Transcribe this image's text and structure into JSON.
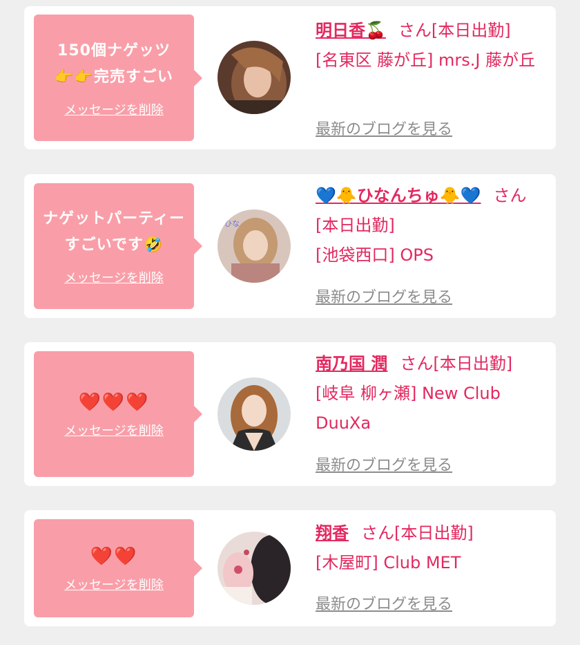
{
  "common": {
    "delete_label": "メッセージを削除",
    "blog_label": "最新のブログを見る",
    "san": "さん",
    "status": "[本日出勤]"
  },
  "colors": {
    "background": "#efefef",
    "card": "#ffffff",
    "bubble": "#f99ea8",
    "accent": "#e2285f",
    "link_gray": "#8c8c8c"
  },
  "messages": [
    {
      "bubble_text": "150個ナゲッツ👉👉完売すごい",
      "name": "明日香🍒",
      "location": "[名東区 藤が丘] mrs.J 藤が丘"
    },
    {
      "bubble_text": "ナゲットパーティーすごいです🤣",
      "name": "💙🐥ひなんちゅ🐥💙",
      "location": "[池袋西口] OPS"
    },
    {
      "bubble_text": "❤️❤️❤️",
      "name": "南乃国 潤",
      "location": "[岐阜 柳ヶ瀬] New Club DuuXa"
    },
    {
      "bubble_text": "❤️❤️",
      "name": "翔香",
      "location": "[木屋町] Club MET"
    }
  ]
}
